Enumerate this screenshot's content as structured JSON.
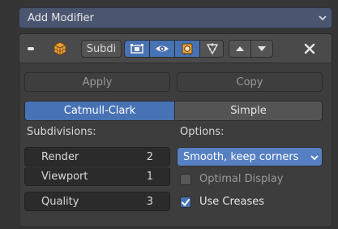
{
  "add_modifier": {
    "label": "Add Modifier"
  },
  "header": {
    "name_value": "Subdi"
  },
  "actions": {
    "apply": "Apply",
    "copy": "Copy"
  },
  "algorithm": {
    "options": [
      "Catmull-Clark",
      "Simple"
    ],
    "selected": "Catmull-Clark"
  },
  "subdivisions": {
    "heading": "Subdivisions:",
    "render": {
      "label": "Render",
      "value": "2"
    },
    "viewport": {
      "label": "Viewport",
      "value": "1"
    },
    "quality": {
      "label": "Quality",
      "value": "3"
    }
  },
  "options": {
    "heading": "Options:",
    "uv_smooth": "Smooth, keep corners",
    "optimal_display": {
      "label": "Optimal Display",
      "checked": false
    },
    "use_creases": {
      "label": "Use Creases",
      "checked": true
    }
  },
  "colors": {
    "accent": "#4772b3",
    "panel": "#3d3d3d",
    "field": "#2b2b2b"
  }
}
